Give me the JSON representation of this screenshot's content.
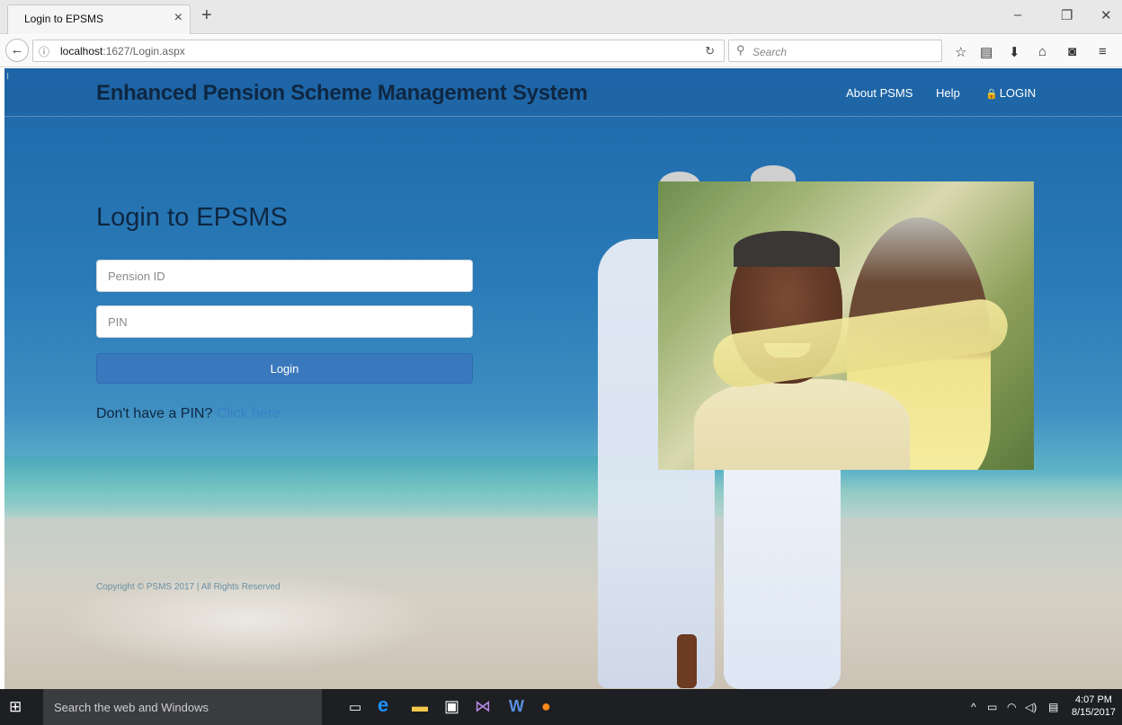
{
  "browser": {
    "tab_title": "Login to EPSMS",
    "tab_close": "×",
    "new_tab": "+",
    "window_controls": {
      "minimize": "–",
      "restore": "❐",
      "close": "✕"
    },
    "back_icon": "back-arrow-icon",
    "url_host": "localhost",
    "url_path": ":1627/Login.aspx",
    "search_placeholder": "Search",
    "toolbar_icons": [
      "bookmark-star-icon",
      "reading-list-icon",
      "download-icon",
      "home-icon",
      "pocket-icon",
      "menu-icon"
    ]
  },
  "site": {
    "brand": "Enhanced Pension Scheme Management System",
    "nav": {
      "about": "About PSMS",
      "help": "Help",
      "login": "LOGIN"
    }
  },
  "login": {
    "title": "Login to EPSMS",
    "pension_id_placeholder": "Pension ID",
    "pin_placeholder": "PIN",
    "button": "Login",
    "no_pin_text": "Don't have a PIN?",
    "click_here": "Click here"
  },
  "footer": {
    "copyright": "Copyright © PSMS 2017 | All Rights Reserved"
  },
  "taskbar": {
    "search_placeholder": "Search the web and Windows",
    "apps": [
      "task-view-icon",
      "edge-icon",
      "file-explorer-icon",
      "store-icon",
      "visual-studio-icon",
      "word-icon",
      "firefox-icon"
    ],
    "time": "4:07 PM",
    "date": "8/15/2017"
  }
}
